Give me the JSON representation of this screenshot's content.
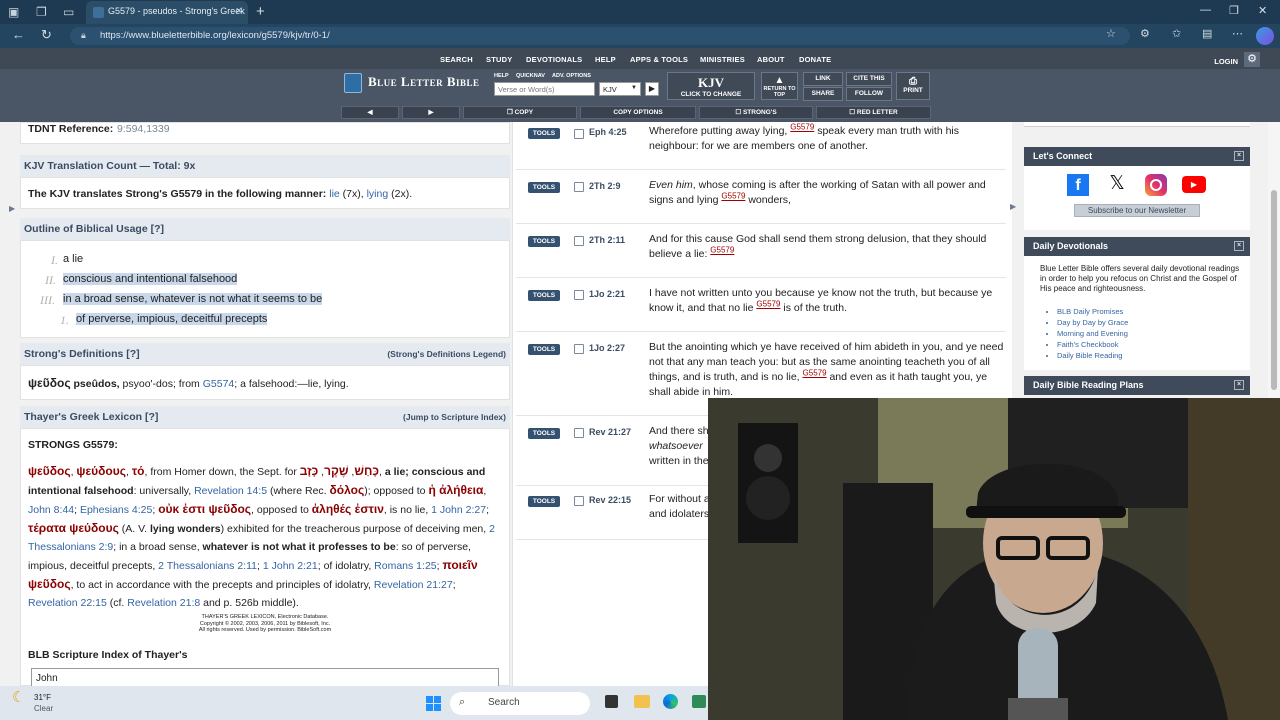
{
  "browser": {
    "tab_title": "G5579 - pseudos - Strong's Greek",
    "url": "https://www.blueletterbible.org/lexicon/g5579/kjv/tr/0-1/"
  },
  "site": {
    "nav": [
      "SEARCH",
      "STUDY",
      "DEVOTIONALS",
      "HELP",
      "APPS & TOOLS",
      "MINISTRIES",
      "ABOUT",
      "DONATE"
    ],
    "login": "LOGIN",
    "logo": "Blue Letter Bible",
    "help": "HELP",
    "quicknav": "QUICKNAV",
    "adv_options": "ADV. OPTIONS",
    "verse_placeholder": "Verse or Word(s)",
    "version": "KJV",
    "kjv_big": "KJV",
    "click_to_change": "CLICK TO CHANGE",
    "return_to_top": "RETURN TO TOP",
    "link": "LINK",
    "cite": "CITE THIS",
    "share": "SHARE",
    "follow": "FOLLOW",
    "print": "PRINT",
    "copy": "COPY",
    "copy_options": "COPY OPTIONS",
    "strongs": "STRONG'S",
    "red_letter": "RED LETTER"
  },
  "left": {
    "tdnt_label": "TDNT Reference:",
    "tdnt_value": "9:594,1339",
    "count_header": "KJV Translation Count — Total: 9x",
    "count_text_a": "The KJV translates Strong's G5579 in the following manner:",
    "count_lie": "lie",
    "count_lie_n": "(7x),",
    "count_lying": "lying",
    "count_lying_n": "(2x).",
    "outline_header": "Outline of Biblical Usage [?]",
    "outline": [
      {
        "num": "I.",
        "text": "a lie"
      },
      {
        "num": "II.",
        "text": "conscious and intentional falsehood"
      },
      {
        "num": "III.",
        "text": "in a broad sense, whatever is not what it seems to be"
      },
      {
        "num": "1.",
        "text": "of perverse, impious, deceitful precepts"
      }
    ],
    "strongs_header": "Strong's Definitions [?]",
    "strongs_legend": "(Strong's Definitions Legend)",
    "strongs_greek": "ψεῦδος",
    "strongs_translit": "pseûdos,",
    "strongs_text_a": "psyoo'-dos; from",
    "strongs_ref": "G5574",
    "strongs_text_b": "; a falsehood:—lie, lying.",
    "thayer_header": "Thayer's Greek Lexicon [?]",
    "thayer_jump": "(Jump to Scripture Index)",
    "thayer_title": "STRONGS G5579:",
    "copyright_1": "THAYER'S GREEK LEXICON, Electronic Database.",
    "copyright_2": "Copyright © 2002, 2003, 2006, 2011 by Biblesoft, Inc.",
    "copyright_3": "All rights reserved. Used by permission. BibleSoft.com",
    "scripture_index": "BLB Scripture Index of Thayer's",
    "john_value": "John"
  },
  "verses": [
    {
      "tools": "TOOLS",
      "ref": "Eph 4:25",
      "pre": "Wherefore putting away lying,",
      "strong": "G5579",
      "post": "speak every man truth with his neighbour: for we are members one of another."
    },
    {
      "tools": "TOOLS",
      "ref": "2Th 2:9",
      "pre_i": "Even him",
      "pre": ", whose coming is after the working of Satan with all power and signs and lying",
      "strong": "G5579",
      "post": "wonders,"
    },
    {
      "tools": "TOOLS",
      "ref": "2Th 2:11",
      "pre": "And for this cause God shall send them strong delusion, that they should believe a lie:",
      "strong": "G5579",
      "post": ""
    },
    {
      "tools": "TOOLS",
      "ref": "1Jo 2:21",
      "pre": "I have not written unto you because ye know not the truth, but because ye know it, and that no lie",
      "strong": "G5579",
      "post": "is of the truth."
    },
    {
      "tools": "TOOLS",
      "ref": "1Jo 2:27",
      "pre": "But the anointing which ye have received of him abideth in you, and ye need not that any man teach you: but as the same anointing teacheth you of all things, and is truth, and is no lie,",
      "strong": "G5579",
      "post": "and even as it hath taught you, ye shall abide in him."
    },
    {
      "tools": "TOOLS",
      "ref": "Rev 21:27",
      "pre": "And there sh",
      "pre_i2": "whatsoever",
      "post2": "written in the"
    },
    {
      "tools": "TOOLS",
      "ref": "Rev 22:15",
      "pre": "For without a",
      "post2": "and idolaters"
    }
  ],
  "right": {
    "connect": "Let's Connect",
    "subscribe": "Subscribe to our Newsletter",
    "devotionals": "Daily Devotionals",
    "devo_text": "Blue Letter Bible offers several daily devotional readings in order to help you refocus on Christ and the Gospel of His peace and righteousness.",
    "devo_items": [
      "BLB Daily Promises",
      "Day by Day by Grace",
      "Morning and Evening",
      "Faith's Checkbook",
      "Daily Bible Reading"
    ],
    "plans": "Daily Bible Reading Plans"
  },
  "taskbar": {
    "temp": "31°F",
    "weather": "Clear",
    "search": "Search"
  },
  "colors": {
    "header": "#4a5565",
    "link": "#3465a4",
    "greek": "#8b0000",
    "tools": "#34516f"
  }
}
